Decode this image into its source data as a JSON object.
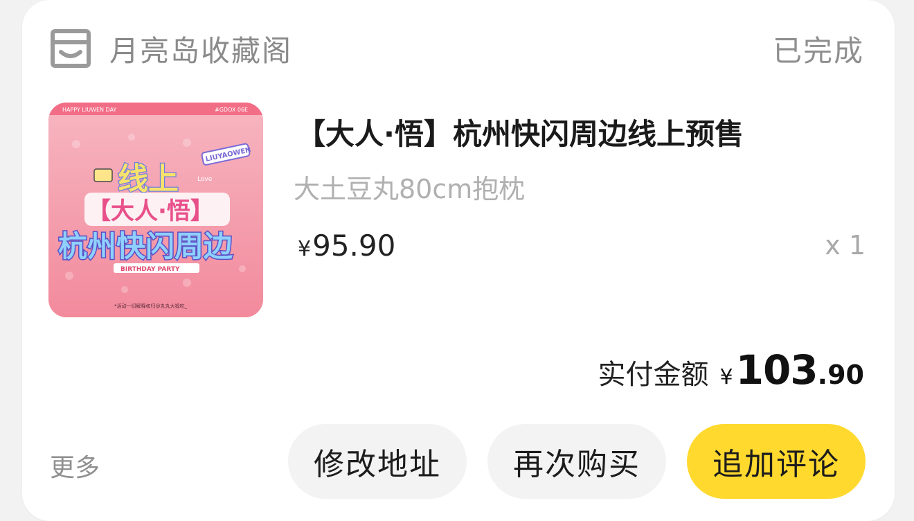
{
  "shop": {
    "name": "月亮岛收藏阁",
    "icon": "shop-icon"
  },
  "order_status": "已完成",
  "product": {
    "title": "【大人·悟】杭州快闪周边线上预售",
    "spec": "大土豆丸80cm抱枕",
    "price_symbol": "¥",
    "price": "95.90",
    "quantity": "x 1",
    "thumbnail": {
      "top_left": "HAPPY LIUWEN DAY",
      "top_right": "#GDOX 06E",
      "badge": "LIUYAOWEN",
      "line1": "线上",
      "line2": "【大人·悟】",
      "line3": "杭州快闪周边",
      "ribbon": "BIRTHDAY PARTY",
      "footer": "*活动一切解释权归@丸丸大福吃_",
      "love": "Love"
    }
  },
  "total": {
    "label": "实付金额",
    "symbol": "¥",
    "integer": "103",
    "decimal": ".90"
  },
  "actions": {
    "more": "更多",
    "edit_address": "修改地址",
    "buy_again": "再次购买",
    "add_review": "追加评论"
  },
  "colors": {
    "accent": "#ffd92e",
    "button_bg": "#f3f3f3",
    "muted_text": "#8a8a8a"
  }
}
